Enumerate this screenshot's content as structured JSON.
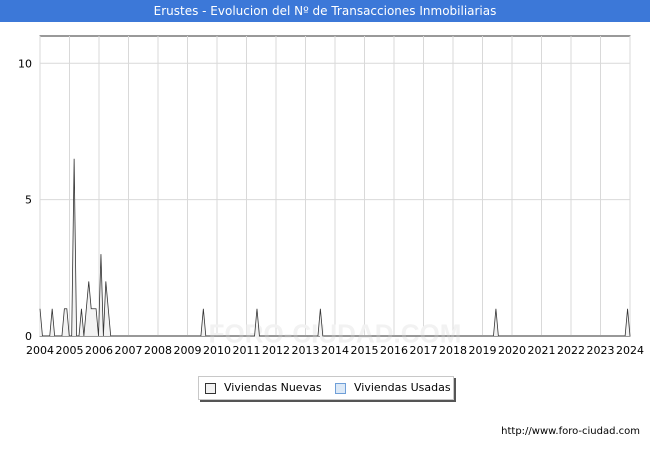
{
  "title": "Erustes - Evolucion del Nº de Transacciones Inmobiliarias",
  "source": "http://www.foro-ciudad.com",
  "watermark": "FORO-CIUDAD.COM",
  "legend": [
    {
      "label": "Viviendas Nuevas",
      "color": "#f2f2f2"
    },
    {
      "label": "Viviendas Usadas",
      "color": "#dce9f7"
    }
  ],
  "chart_data": {
    "type": "area",
    "x_ticks": [
      "2004",
      "2005",
      "2006",
      "2007",
      "2008",
      "2009",
      "2010",
      "2011",
      "2012",
      "2013",
      "2014",
      "2015",
      "2016",
      "2017",
      "2018",
      "2019",
      "2020",
      "2021",
      "2022",
      "2023",
      "2024"
    ],
    "y_ticks": [
      "0",
      "5",
      "10"
    ],
    "ylim": [
      0,
      11
    ],
    "grid": true,
    "legend_position": "bottom",
    "series": [
      {
        "name": "Viviendas Nuevas",
        "color": "#333333",
        "fill": "#f2f2f2",
        "values": [
          1,
          0,
          0,
          0,
          0,
          1,
          0,
          0,
          0,
          0,
          1,
          1,
          0,
          0,
          6.5,
          0,
          0,
          1,
          0,
          1,
          2,
          1,
          1,
          1,
          0,
          3,
          0,
          2,
          1,
          0,
          0,
          0,
          0,
          0,
          0,
          0,
          0,
          0,
          0,
          0,
          0,
          0,
          0,
          0,
          0,
          0,
          0,
          0,
          0,
          0,
          0,
          0,
          0,
          0,
          0,
          0,
          0,
          0,
          0,
          0,
          0,
          0,
          0,
          0,
          0,
          0,
          0,
          1,
          0,
          0,
          0,
          0,
          0,
          0,
          0,
          0,
          0,
          0,
          0,
          0,
          0,
          0,
          0,
          0,
          0,
          0,
          0,
          0,
          0,
          1,
          0,
          0,
          0,
          0,
          0,
          0,
          0,
          0,
          0,
          0,
          0,
          0,
          0,
          0,
          0,
          0,
          0,
          0,
          0,
          0,
          0,
          0,
          0,
          0,
          0,
          1,
          0,
          0,
          0,
          0,
          0,
          0,
          0,
          0,
          0,
          0,
          0,
          0,
          0,
          0,
          0,
          0,
          0,
          0,
          0,
          0,
          0,
          0,
          0,
          0,
          0,
          0,
          0,
          0,
          0,
          0,
          0,
          0,
          0,
          0,
          0,
          0,
          0,
          0,
          0,
          0,
          0,
          0,
          0,
          0,
          0,
          0,
          0,
          0,
          0,
          0,
          0,
          0,
          0,
          0,
          0,
          0,
          0,
          0,
          0,
          0,
          0,
          0,
          0,
          0,
          0,
          0,
          0,
          0,
          0,
          0,
          0,
          1,
          0,
          0,
          0,
          0,
          0,
          0,
          0,
          0,
          0,
          0,
          0,
          0,
          0,
          0,
          0,
          0,
          0,
          0,
          0,
          0,
          0,
          0,
          0,
          0,
          0,
          0,
          0,
          0,
          0,
          0,
          0,
          0,
          0,
          0,
          0,
          0,
          0,
          0,
          0,
          0,
          0,
          0,
          0,
          0,
          0,
          0,
          0,
          0,
          0,
          0,
          0,
          0,
          0,
          1,
          0
        ]
      }
    ]
  }
}
